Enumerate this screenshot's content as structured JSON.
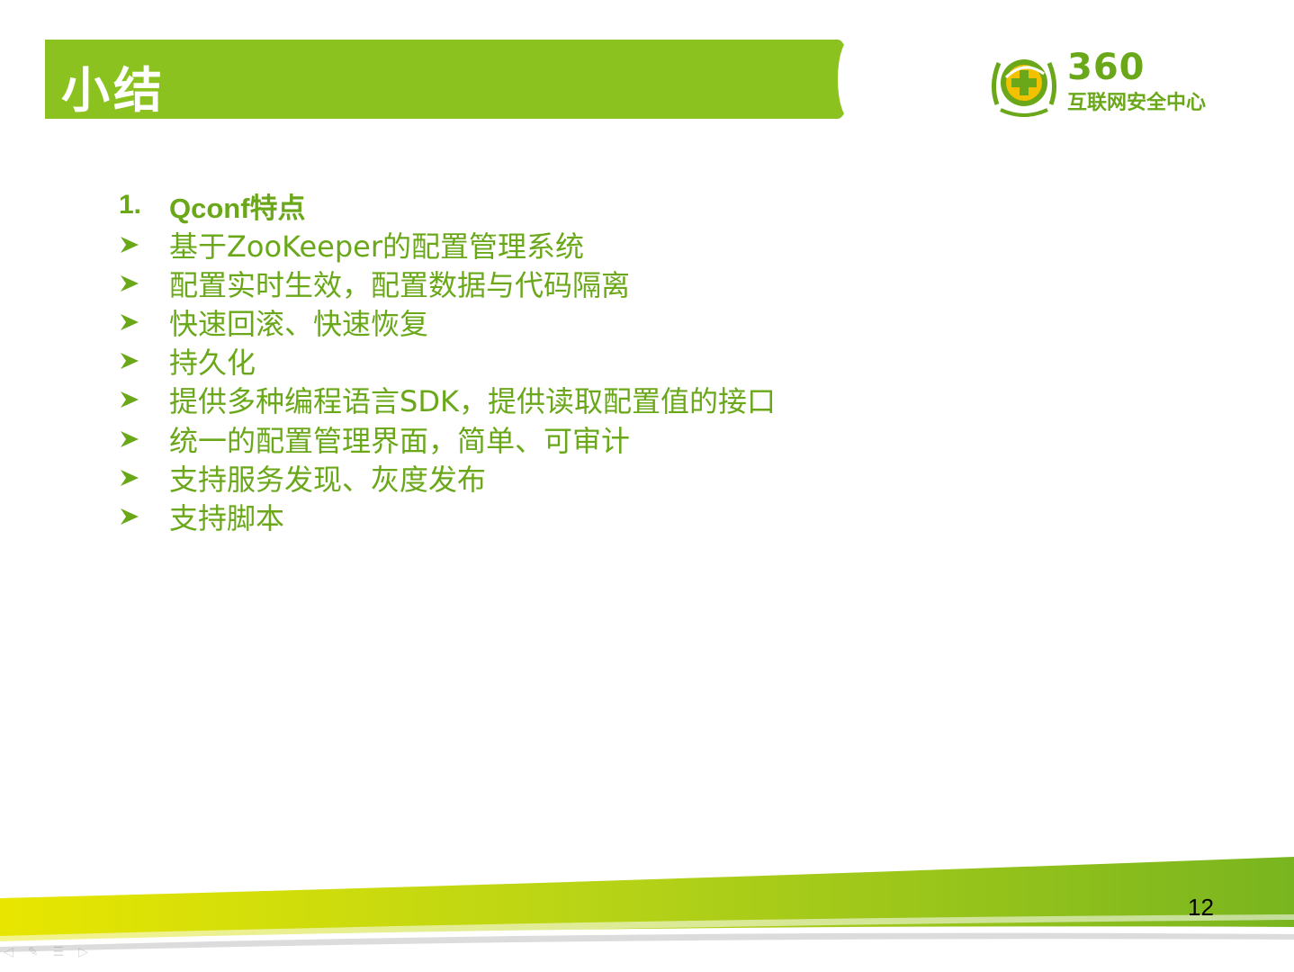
{
  "slide": {
    "title": "小结",
    "logo": {
      "number": "360",
      "name": "互联网安全中心"
    },
    "heading": {
      "number": "1.",
      "text": "Qconf特点"
    },
    "bullets": [
      "基于ZooKeeper的配置管理系统",
      "配置实时生效，配置数据与代码隔离",
      "快速回滚、快速恢复",
      "持久化",
      "提供多种编程语言SDK，提供读取配置值的接口",
      "统一的配置管理界面，简单、可审计",
      "支持服务发现、灰度发布",
      "支持脚本"
    ],
    "page_number": "12"
  },
  "colors": {
    "accent_green": "#8cc21f",
    "text_green": "#6aa81a",
    "swoosh_yellow": "#e8e600"
  },
  "icons": {
    "bullet": "arrow-bullet-icon",
    "logo": "360-shield-logo-icon"
  }
}
